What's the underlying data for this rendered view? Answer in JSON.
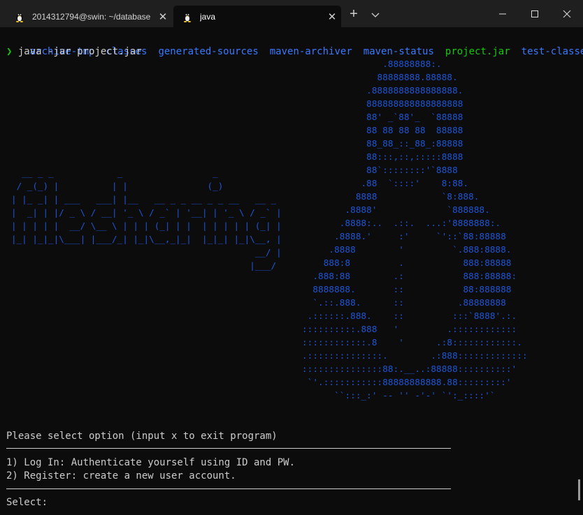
{
  "tabs": [
    {
      "title": "2014312794@swin: ~/database",
      "icon": "linux-penguin-icon",
      "active": false
    },
    {
      "title": "java",
      "icon": "linux-penguin-icon",
      "active": true
    }
  ],
  "titlebar": {
    "new_tab": "+",
    "close": "✕"
  },
  "terminal": {
    "ls_items": [
      {
        "name": "archive-tmp",
        "type": "dir"
      },
      {
        "name": "classes",
        "type": "dir"
      },
      {
        "name": "generated-sources",
        "type": "dir"
      },
      {
        "name": "maven-archiver",
        "type": "dir"
      },
      {
        "name": "maven-status",
        "type": "dir"
      },
      {
        "name": "project.jar",
        "type": "file"
      },
      {
        "name": "test-classes",
        "type": "dir"
      }
    ],
    "prompt_symbol": "❯",
    "command": "java -jar project.jar",
    "art_text": "  __ _ _            _                 _\n / _(_) |          | |               (_)\n| |_ _| | ___   ___| |__   __ _ _ __ _ _ __   __ _\n|  _| | |/ _ \\ / __| '_ \\ / _` | '__| | '_ \\ / _` |\n| | | | |  __/ \\__ \\ | | | (_| | |  | | | | | (_| |\n|_| |_|_|\\___| |___/_| |_|\\__,_|_|  |_|_| |_|\\__, |\n                                              __/ |\n                                             |___/",
    "art_logo": "               .88888888:.\n              88888888.88888.\n            .8888888888888888.\n            888888888888888888\n            88' _`88'_  `88888\n            88 88 88 88  88888\n            88_88_::_88_:88888\n            88:::,::,:::::8888\n            88`::::::::'`8888\n           .88  `::::'    8:88.\n          8888            `8:888.\n        .8888'             `888888.\n       .8888:..  .::.  ...:'8888888:.\n      .8888.'     :'     `'::`88:88888\n     .8888        '         `.888:8888.\n    888:8         .           888:88888\n  .888:88        .:           888:88888:\n  8888888.       ::           88:888888\n  `.::.888.      ::          .88888888\n .::::::.888.    ::         :::`8888'.:.\n::::::::::.888   '         .::::::::::::\n::::::::::::.8    '      .:8::::::::::::.\n.::::::::::::::.        .:888:::::::::::::\n:::::::::::::::88:.__..:88888::::::::::'\n `'.:::::::::::88888888888.88:::::::::'\n      ``:::_:' -- '' -'-' `':_::::'`",
    "menu_header": "Please select option (input x to exit program)",
    "options": [
      "1) Log In: Authenticate yourself using ID and PW.",
      "2) Register: create a new user account."
    ],
    "select_prompt": "Select:"
  },
  "colors": {
    "background": "#0c0c0c",
    "dir": "#3b78ff",
    "jar": "#16c60c",
    "art": "#1f55d6",
    "text": "#cccccc"
  }
}
